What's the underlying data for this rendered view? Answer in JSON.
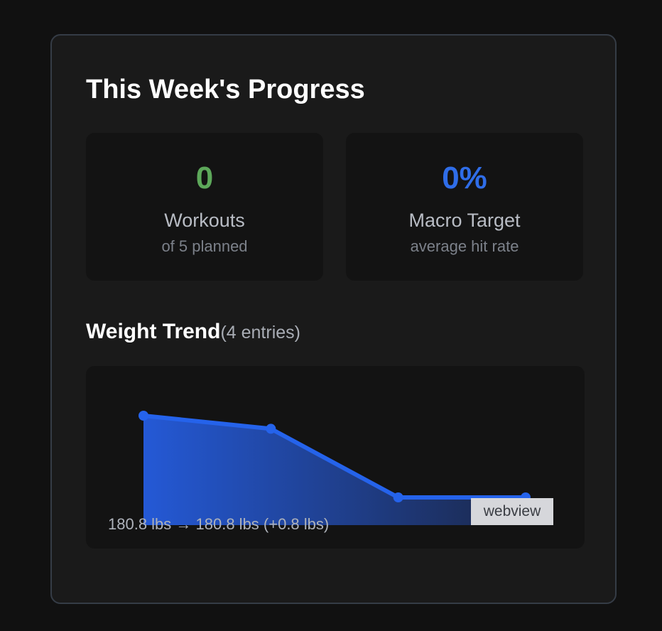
{
  "panel": {
    "title": "This Week's Progress"
  },
  "stats": [
    {
      "value": "0",
      "label": "Workouts",
      "sublabel": "of 5 planned",
      "color": "#5da85a"
    },
    {
      "value": "0%",
      "label": "Macro Target",
      "sublabel": "average hit rate",
      "color": "#2f6de8"
    }
  ],
  "weight_trend": {
    "title": "Weight Trend",
    "count_label": "(4 entries)",
    "summary": "180.8 lbs → 180.8 lbs (+0.8 lbs)",
    "overlay_label": "webview",
    "line_color": "#2563eb"
  },
  "chart_data": {
    "type": "area",
    "title": "Weight Trend",
    "x": [
      1,
      2,
      3,
      4
    ],
    "series": [
      {
        "values": [
          1.0,
          0.84,
          0.0,
          0.0
        ]
      }
    ]
  }
}
